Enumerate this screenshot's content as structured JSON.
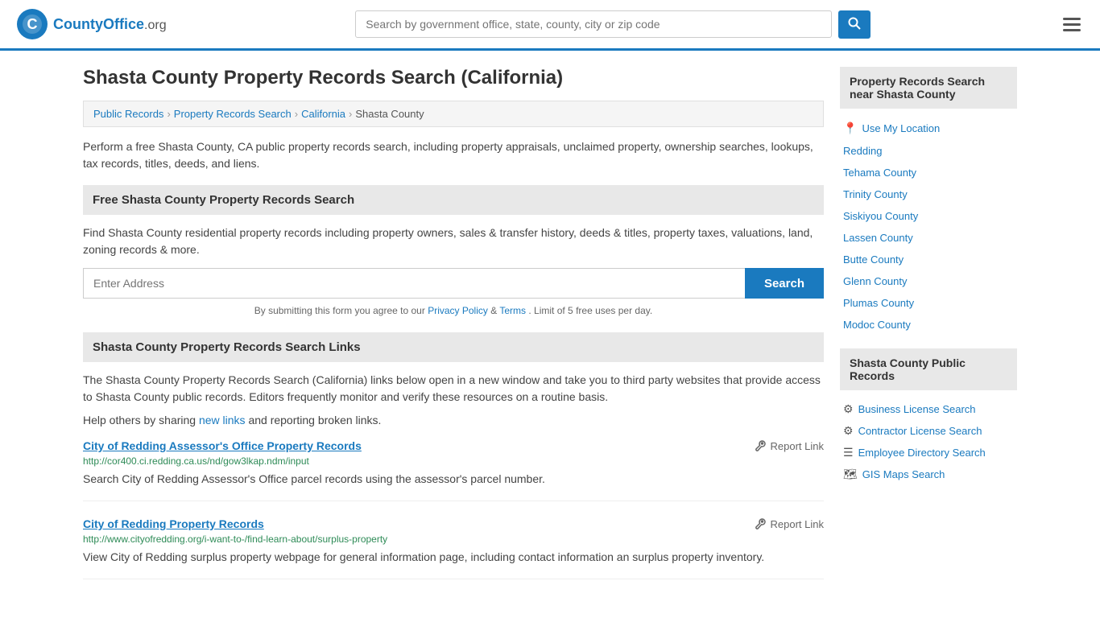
{
  "header": {
    "logo_text": "CountyOffice",
    "logo_suffix": ".org",
    "search_placeholder": "Search by government office, state, county, city or zip code"
  },
  "page": {
    "title": "Shasta County Property Records Search (California)",
    "description": "Perform a free Shasta County, CA public property records search, including property appraisals, unclaimed property, ownership searches, lookups, tax records, titles, deeds, and liens."
  },
  "breadcrumb": {
    "items": [
      "Public Records",
      "Property Records Search",
      "California",
      "Shasta County"
    ]
  },
  "free_search": {
    "header": "Free Shasta County Property Records Search",
    "description": "Find Shasta County residential property records including property owners, sales & transfer history, deeds & titles, property taxes, valuations, land, zoning records & more.",
    "address_placeholder": "Enter Address",
    "search_button": "Search",
    "disclaimer_text": "By submitting this form you agree to our",
    "privacy_link": "Privacy Policy",
    "terms_link": "Terms",
    "limit_text": ". Limit of 5 free uses per day."
  },
  "links_section": {
    "header": "Shasta County Property Records Search Links",
    "description": "The Shasta County Property Records Search (California) links below open in a new window and take you to third party websites that provide access to Shasta County public records. Editors frequently monitor and verify these resources on a routine basis.",
    "share_text": "Help others by sharing",
    "share_link_text": "new links",
    "share_suffix": "and reporting broken links.",
    "records": [
      {
        "title": "City of Redding Assessor's Office Property Records",
        "url": "http://cor400.ci.redding.ca.us/nd/gow3lkap.ndm/input",
        "description": "Search City of Redding Assessor's Office parcel records using the assessor's parcel number.",
        "report_label": "Report Link"
      },
      {
        "title": "City of Redding Property Records",
        "url": "http://www.cityofredding.org/i-want-to-/find-learn-about/surplus-property",
        "description": "View City of Redding surplus property webpage for general information page, including contact information an surplus property inventory.",
        "report_label": "Report Link"
      }
    ]
  },
  "sidebar": {
    "nearby_header": "Property Records Search near Shasta County",
    "use_my_location": "Use My Location",
    "nearby_links": [
      "Redding",
      "Tehama County",
      "Trinity County",
      "Siskiyou County",
      "Lassen County",
      "Butte County",
      "Glenn County",
      "Plumas County",
      "Modoc County"
    ],
    "public_records_header": "Shasta County Public Records",
    "public_records_links": [
      {
        "label": "Business License Search",
        "icon": "gear"
      },
      {
        "label": "Contractor License Search",
        "icon": "gear"
      },
      {
        "label": "Employee Directory Search",
        "icon": "list"
      },
      {
        "label": "GIS Maps Search",
        "icon": "map"
      }
    ]
  }
}
